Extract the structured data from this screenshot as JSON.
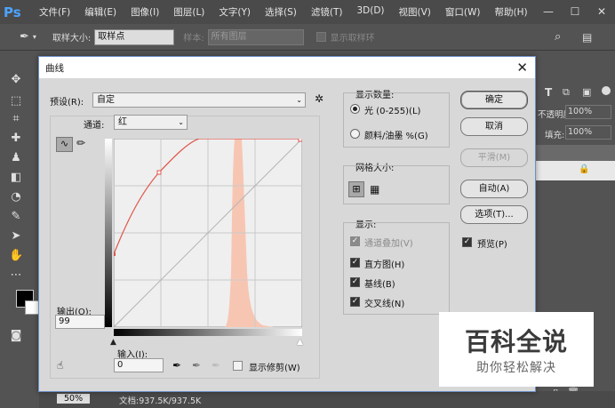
{
  "app": {
    "logo": "Ps"
  },
  "menu": [
    "文件(F)",
    "编辑(E)",
    "图像(I)",
    "图层(L)",
    "文字(Y)",
    "选择(S)",
    "滤镜(T)",
    "3D(D)",
    "视图(V)",
    "窗口(W)",
    "帮助(H)"
  ],
  "window_controls": {
    "min": "—",
    "max": "☐",
    "close": "✕"
  },
  "options": {
    "sample_size_label": "取样大小:",
    "sample_size_value": "取样点",
    "sample_label": "样本:",
    "sample_value": "所有图层",
    "show_ring": "显示取样环"
  },
  "right_panel": {
    "opacity_label": "不透明度:",
    "opacity_value": "100%",
    "fill_label": "填充:",
    "fill_value": "100%"
  },
  "status": {
    "zoom": "50%",
    "doc": "文档:937.5K/937.5K"
  },
  "dialog": {
    "title": "曲线",
    "preset_label": "预设(R):",
    "preset_value": "自定",
    "channel_label": "通道:",
    "channel_value": "红",
    "output_label": "输出(O):",
    "output_value": "99",
    "input_label": "输入(I):",
    "input_value": "0",
    "show_clipping": "显示修剪(W)",
    "display_amount": {
      "title": "显示数量:",
      "light": "光 (0-255)(L)",
      "pigment": "颜料/油墨 %(G)"
    },
    "grid_size": {
      "title": "网格大小:"
    },
    "display": {
      "title": "显示:",
      "channel_overlay": "通道叠加(V)",
      "histogram": "直方图(H)",
      "baseline": "基线(B)",
      "intersection": "交叉线(N)"
    },
    "buttons": {
      "ok": "确定",
      "cancel": "取消",
      "smooth": "平滑(M)",
      "auto": "自动(A)",
      "options": "选项(T)...",
      "preview": "预览(P)"
    }
  },
  "watermark": {
    "title": "百科全说",
    "subtitle": "助你轻松解决"
  },
  "colors": {
    "curve": "#e0564a",
    "histogram": "#f7c6b3",
    "accent": "#4da3ff"
  }
}
